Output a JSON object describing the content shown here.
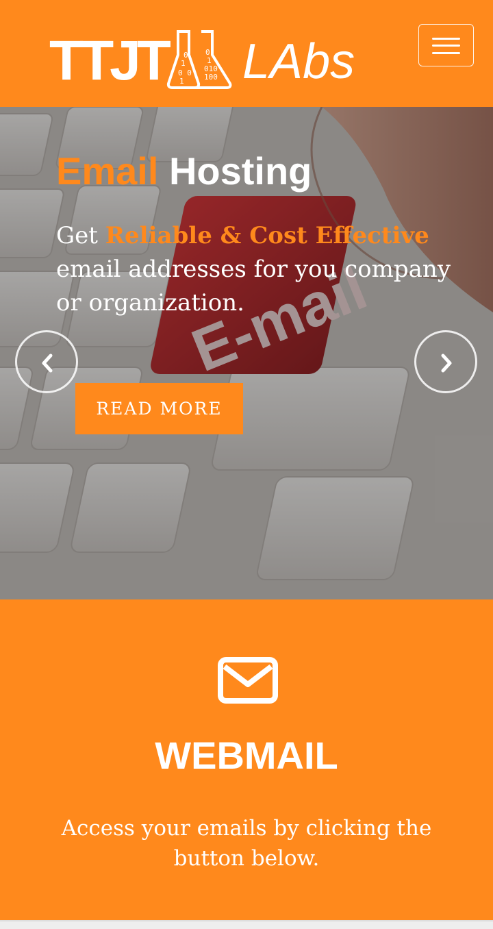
{
  "colors": {
    "brand_orange": "#ff891c",
    "text_white": "#ffffff"
  },
  "header": {
    "logo_text": "TTJT LAbs",
    "menu_icon": "hamburger-icon"
  },
  "hero": {
    "title_accent": "Email",
    "title_rest": "Hosting",
    "text_prefix": "Get",
    "text_accent": "Reliable & Cost Effective",
    "text_suffix": "email addresses for you company or organization.",
    "button_label": "READ MORE",
    "prev_icon": "chevron-left-icon",
    "next_icon": "chevron-right-icon"
  },
  "webmail": {
    "icon": "envelope-icon",
    "title": "WEBMAIL",
    "description": "Access your emails by clicking the button below."
  }
}
